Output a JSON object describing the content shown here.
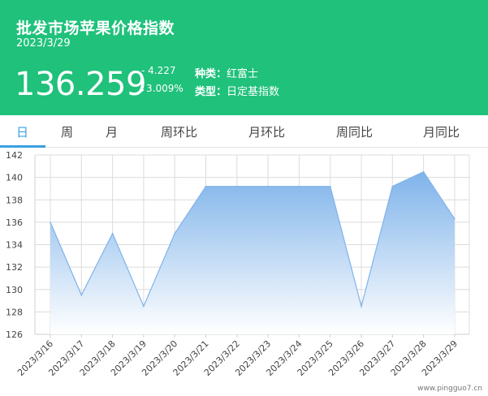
{
  "header": {
    "title": "批发市场苹果价格指数",
    "date": "2023/3/29",
    "price": "136.259",
    "change": "- 4.227",
    "change_pct": "↓3.009%",
    "kind_label": "种类：",
    "kind_value": "红富士",
    "type_label": "类型：",
    "type_value": "日定基指数",
    "bg_color": "#1fc17b"
  },
  "tabs": [
    {
      "label": "日",
      "active": true
    },
    {
      "label": "周",
      "active": false
    },
    {
      "label": "月",
      "active": false
    },
    {
      "label": "周环比",
      "active": false
    },
    {
      "label": "月环比",
      "active": false
    },
    {
      "label": "周同比",
      "active": false
    },
    {
      "label": "月同比",
      "active": false
    }
  ],
  "watermark": "www.pingguo7.cn",
  "chart_data": {
    "type": "area",
    "categories": [
      "2023/3/16",
      "2023/3/17",
      "2023/3/18",
      "2023/3/19",
      "2023/3/20",
      "2023/3/21",
      "2023/3/22",
      "2023/3/23",
      "2023/3/24",
      "2023/3/25",
      "2023/3/26",
      "2023/3/27",
      "2023/3/28",
      "2023/3/29"
    ],
    "values": [
      136.0,
      129.5,
      135.0,
      128.5,
      135.0,
      139.2,
      139.2,
      139.2,
      139.2,
      139.2,
      128.5,
      139.2,
      140.5,
      136.3
    ],
    "ylim": [
      126,
      142
    ],
    "yticks": [
      126,
      128,
      130,
      132,
      134,
      136,
      138,
      140,
      142
    ],
    "grid": true,
    "line_color": "#7fb3ea",
    "fill_top": "#7fb3ea",
    "fill_bottom": "#ffffff"
  }
}
